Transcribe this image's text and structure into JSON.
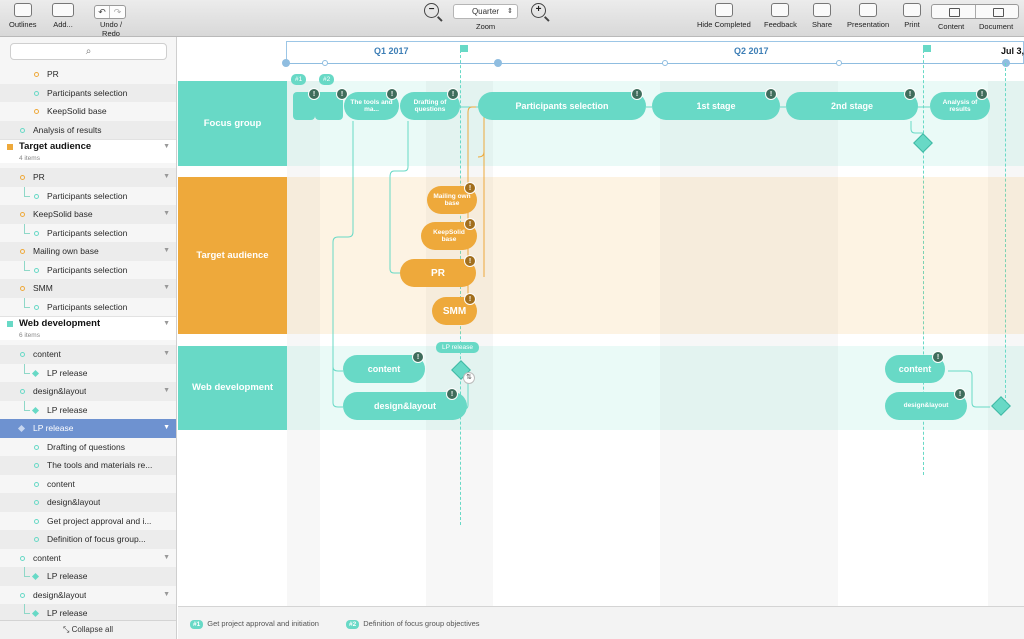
{
  "toolbar": {
    "outlines": "Outlines",
    "add": "Add...",
    "undo_redo": "Undo / Redo",
    "zoom_value": "Quarter",
    "zoom_label": "Zoom",
    "hide_completed": "Hide Completed",
    "feedback": "Feedback",
    "share": "Share",
    "presentation": "Presentation",
    "print": "Print",
    "content": "Content",
    "document": "Document"
  },
  "sidebar": {
    "rows": [
      {
        "label": "PR"
      },
      {
        "label": "Participants selection"
      },
      {
        "label": "KeepSolid base"
      },
      {
        "label": "Analysis of results"
      },
      {
        "label": "Target audience",
        "sub": "4 items"
      },
      {
        "label": "PR"
      },
      {
        "label": "Participants selection"
      },
      {
        "label": "KeepSolid base"
      },
      {
        "label": "Participants selection"
      },
      {
        "label": "Mailing own base"
      },
      {
        "label": "Participants selection"
      },
      {
        "label": "SMM"
      },
      {
        "label": "Participants selection"
      },
      {
        "label": "Web development",
        "sub": "6 items"
      },
      {
        "label": "content"
      },
      {
        "label": "LP release"
      },
      {
        "label": "design&layout"
      },
      {
        "label": "LP release"
      },
      {
        "label": "LP release"
      },
      {
        "label": "Drafting of questions"
      },
      {
        "label": "The tools and materials re..."
      },
      {
        "label": "content"
      },
      {
        "label": "design&layout"
      },
      {
        "label": "Get project approval and i..."
      },
      {
        "label": "Definition of focus group..."
      },
      {
        "label": "content"
      },
      {
        "label": "LP release"
      },
      {
        "label": "design&layout"
      },
      {
        "label": "LP release"
      }
    ],
    "collapse_all": "Collapse all"
  },
  "timeline": {
    "q1": "Q1 2017",
    "q2": "Q2 2017",
    "jul": "Jul 3,"
  },
  "lanes": {
    "focus": "Focus group",
    "target": "Target audience",
    "web": "Web development"
  },
  "tasks": {
    "t1": "#1",
    "t2": "#2",
    "tools": "The tools and ma...",
    "drafting": "Drafting of questions",
    "participants": "Participants selection",
    "stage1": "1st stage",
    "stage2": "2nd stage",
    "analysis": "Analysis of results",
    "mailing": "Mailing own base",
    "keepsolid": "KeepSolid base",
    "pr": "PR",
    "smm": "SMM",
    "lp_release": "LP release",
    "content": "content",
    "design": "design&layout",
    "content2": "content",
    "design2": "design&layout",
    "badge": "!"
  },
  "footer": {
    "n1_tag": "#1",
    "n1": "Get project approval and initiation",
    "n2_tag": "#2",
    "n2": "Definition of focus group objectives"
  },
  "colors": {
    "teal": "#68d9c6",
    "orange": "#eea93b",
    "selection": "#6e92d0",
    "quarter_blue": "#3e7fb6"
  }
}
